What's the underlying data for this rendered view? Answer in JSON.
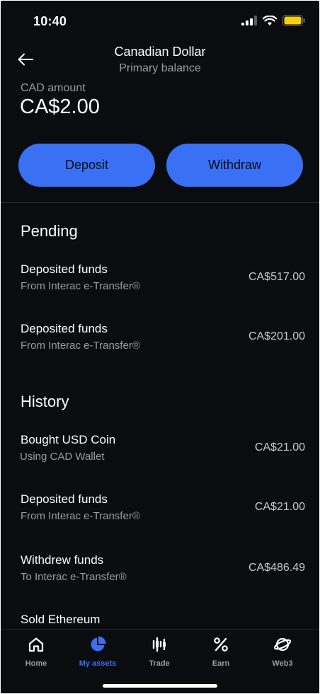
{
  "status_bar": {
    "time": "10:40"
  },
  "header": {
    "title": "Canadian Dollar",
    "subtitle": "Primary balance"
  },
  "balance": {
    "label": "CAD amount",
    "value": "CA$2.00"
  },
  "actions": {
    "deposit_label": "Deposit",
    "withdraw_label": "Withdraw"
  },
  "pending": {
    "title": "Pending",
    "items": [
      {
        "title": "Deposited funds",
        "subtitle": "From Interac e-Transfer®",
        "amount": "CA$517.00"
      },
      {
        "title": "Deposited funds",
        "subtitle": "From Interac e-Transfer®",
        "amount": "CA$201.00"
      }
    ]
  },
  "history": {
    "title": "History",
    "items": [
      {
        "title": "Bought USD Coin",
        "subtitle": "Using CAD Wallet",
        "amount": "CA$21.00"
      },
      {
        "title": "Deposited funds",
        "subtitle": "From Interac e-Transfer®",
        "amount": "CA$21.00"
      },
      {
        "title": "Withdrew funds",
        "subtitle": "To Interac e-Transfer®",
        "amount": "CA$486.49"
      },
      {
        "title": "Sold Ethereum",
        "subtitle": "",
        "amount": ""
      }
    ]
  },
  "nav": {
    "items": [
      {
        "label": "Home",
        "icon": "home-icon"
      },
      {
        "label": "My assets",
        "icon": "pie-chart-icon"
      },
      {
        "label": "Trade",
        "icon": "trade-icon"
      },
      {
        "label": "Earn",
        "icon": "percent-icon"
      },
      {
        "label": "Web3",
        "icon": "planet-icon"
      }
    ],
    "active_index": 1
  },
  "colors": {
    "accent": "#3a70f4",
    "background": "#0b0c10",
    "muted_text": "#9a9ca3",
    "battery": "#f5d00c"
  }
}
